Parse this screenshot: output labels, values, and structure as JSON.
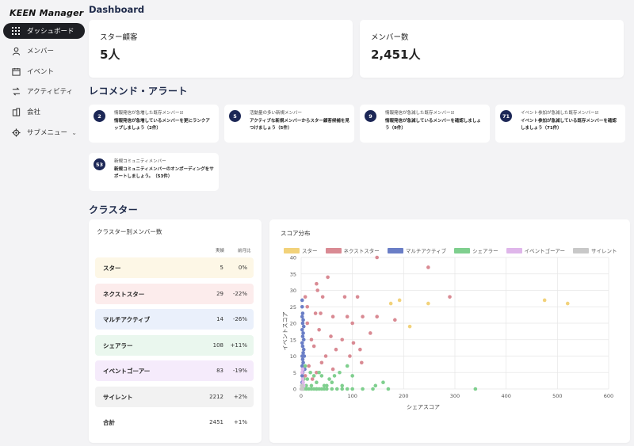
{
  "app": {
    "logo": "KEEN Manager"
  },
  "sidebar": {
    "items": [
      {
        "label": "ダッシュボード",
        "icon": "grid-icon"
      },
      {
        "label": "メンバー",
        "icon": "person-icon"
      },
      {
        "label": "イベント",
        "icon": "calendar-icon"
      },
      {
        "label": "アクティビティ",
        "icon": "activity-icon"
      },
      {
        "label": "会社",
        "icon": "building-icon"
      },
      {
        "label": "サブメニュー",
        "icon": "gear-icon"
      }
    ]
  },
  "header": {
    "title": "Dashboard"
  },
  "kpis": [
    {
      "label": "スター顧客",
      "value": "5人"
    },
    {
      "label": "メンバー数",
      "value": "2,451人"
    }
  ],
  "recommend": {
    "title": "レコメンド・アラート",
    "cards": [
      {
        "count": "2",
        "title": "情報発信が急増した既存メンバー☑",
        "body": "情報発信が急増しているメンバーを更にランクアップしましょう（2件）"
      },
      {
        "count": "5",
        "title": "活動量の多い新規メンバー",
        "body": "アクティブな新規メンバーからスター顧客候補を見つけましょう（5件）"
      },
      {
        "count": "9",
        "title": "情報発信が急減した既存メンバー☑",
        "body": "情報発信が急減しているメンバーを確認しましょう（9件）"
      },
      {
        "count": "71",
        "title": "イベント参加が急減した既存メンバー☑",
        "body": "イベント参加が急減している既存メンバーを確認しましょう（71件）"
      },
      {
        "count": "53",
        "title": "新規コミュニティメンバー",
        "body": "新規コミュニティメンバーのオンボーディングをサポートしましょう。（53件）"
      }
    ]
  },
  "cluster": {
    "title": "クラスター",
    "table": {
      "title": "クラスター別メンバー数",
      "col_actual": "実績",
      "col_prev": "前月比",
      "rows": [
        {
          "name": "スター",
          "actual": "5",
          "prev": "0%",
          "color": "#fdf7e6"
        },
        {
          "name": "ネクストスター",
          "actual": "29",
          "prev": "-22%",
          "color": "#fcecec"
        },
        {
          "name": "マルチアクティブ",
          "actual": "14",
          "prev": "-26%",
          "color": "#eaf0fb"
        },
        {
          "name": "シェアラー",
          "actual": "108",
          "prev": "+11%",
          "color": "#eaf7ee"
        },
        {
          "name": "イベントゴーアー",
          "actual": "83",
          "prev": "-19%",
          "color": "#f5ebfb"
        },
        {
          "name": "サイレント",
          "actual": "2212",
          "prev": "+2%",
          "color": "#f2f2f2"
        },
        {
          "name": "合計",
          "actual": "2451",
          "prev": "+1%",
          "color": "#ffffff"
        }
      ]
    }
  },
  "chart_data": {
    "type": "scatter",
    "title": "スコア分布",
    "xlabel": "シェアスコア",
    "ylabel": "イベントスコア",
    "xlim": [
      0,
      600
    ],
    "ylim": [
      0,
      40
    ],
    "x_ticks": [
      0,
      100,
      200,
      300,
      400,
      500,
      600
    ],
    "y_ticks": [
      0,
      5,
      10,
      15,
      20,
      25,
      30,
      35,
      40
    ],
    "legend_position": "top",
    "series": [
      {
        "name": "スター",
        "color": "#f2d27a",
        "points": [
          [
            175,
            26
          ],
          [
            192,
            27
          ],
          [
            248,
            26
          ],
          [
            212,
            19
          ],
          [
            475,
            27
          ],
          [
            520,
            26
          ]
        ]
      },
      {
        "name": "ネクストスター",
        "color": "#d98a93",
        "points": [
          [
            148,
            40
          ],
          [
            248,
            37
          ],
          [
            30,
            32
          ],
          [
            52,
            34
          ],
          [
            32,
            30
          ],
          [
            42,
            28
          ],
          [
            85,
            28
          ],
          [
            110,
            28
          ],
          [
            28,
            23
          ],
          [
            38,
            23
          ],
          [
            62,
            22
          ],
          [
            90,
            22
          ],
          [
            120,
            22
          ],
          [
            148,
            22
          ],
          [
            183,
            21
          ],
          [
            12,
            20
          ],
          [
            35,
            18
          ],
          [
            58,
            16
          ],
          [
            80,
            15
          ],
          [
            102,
            14
          ],
          [
            25,
            13
          ],
          [
            68,
            12
          ],
          [
            48,
            10
          ],
          [
            95,
            10
          ],
          [
            115,
            12
          ],
          [
            118,
            8
          ],
          [
            15,
            7
          ],
          [
            30,
            5
          ],
          [
            62,
            6
          ],
          [
            8,
            4
          ],
          [
            22,
            3
          ],
          [
            8,
            28
          ],
          [
            12,
            25
          ],
          [
            20,
            15
          ],
          [
            40,
            8
          ],
          [
            100,
            20
          ],
          [
            135,
            17
          ],
          [
            290,
            28
          ]
        ]
      },
      {
        "name": "マルチアクティブ",
        "color": "#6a7ec6",
        "points": [
          [
            2,
            27
          ],
          [
            2,
            25
          ],
          [
            3,
            23
          ],
          [
            2,
            22
          ],
          [
            4,
            21
          ],
          [
            3,
            20
          ],
          [
            5,
            19
          ],
          [
            2,
            18
          ],
          [
            4,
            17
          ],
          [
            3,
            16
          ],
          [
            5,
            15
          ],
          [
            2,
            14
          ],
          [
            3,
            13
          ],
          [
            5,
            12
          ],
          [
            4,
            11
          ],
          [
            2,
            10
          ],
          [
            3,
            9
          ],
          [
            4,
            8
          ],
          [
            2,
            7
          ],
          [
            5,
            6
          ],
          [
            3,
            5
          ],
          [
            2,
            4
          ],
          [
            4,
            3
          ],
          [
            2,
            2
          ],
          [
            3,
            1
          ],
          [
            6,
            10
          ],
          [
            7,
            6
          ]
        ]
      },
      {
        "name": "シェアラー",
        "color": "#7fcf8e",
        "points": [
          [
            5,
            0
          ],
          [
            10,
            0
          ],
          [
            15,
            0
          ],
          [
            20,
            0
          ],
          [
            25,
            0
          ],
          [
            30,
            0
          ],
          [
            35,
            0
          ],
          [
            40,
            0
          ],
          [
            45,
            0
          ],
          [
            50,
            0
          ],
          [
            60,
            0
          ],
          [
            70,
            0
          ],
          [
            80,
            0
          ],
          [
            90,
            0
          ],
          [
            100,
            0
          ],
          [
            120,
            0
          ],
          [
            140,
            0
          ],
          [
            170,
            0
          ],
          [
            340,
            0
          ],
          [
            10,
            1
          ],
          [
            20,
            1
          ],
          [
            30,
            2
          ],
          [
            45,
            1
          ],
          [
            60,
            2
          ],
          [
            80,
            1
          ],
          [
            12,
            3
          ],
          [
            25,
            4
          ],
          [
            40,
            4
          ],
          [
            55,
            3
          ],
          [
            75,
            5
          ],
          [
            100,
            4
          ],
          [
            18,
            5
          ],
          [
            35,
            5
          ],
          [
            8,
            7
          ],
          [
            90,
            7
          ],
          [
            160,
            2
          ],
          [
            145,
            1
          ],
          [
            5,
            3
          ],
          [
            65,
            4
          ],
          [
            30,
            0
          ],
          [
            50,
            1
          ]
        ]
      },
      {
        "name": "イベントゴーアー",
        "color": "#dfb6ea",
        "points": [
          [
            2,
            1
          ],
          [
            4,
            2
          ],
          [
            3,
            3
          ],
          [
            5,
            1
          ],
          [
            2,
            5
          ],
          [
            3,
            6
          ]
        ]
      },
      {
        "name": "サイレント",
        "color": "#c8c8c8",
        "points": [
          [
            0,
            0
          ],
          [
            1,
            0
          ],
          [
            2,
            0
          ],
          [
            3,
            0
          ],
          [
            1,
            1
          ],
          [
            2,
            1
          ]
        ]
      }
    ]
  }
}
